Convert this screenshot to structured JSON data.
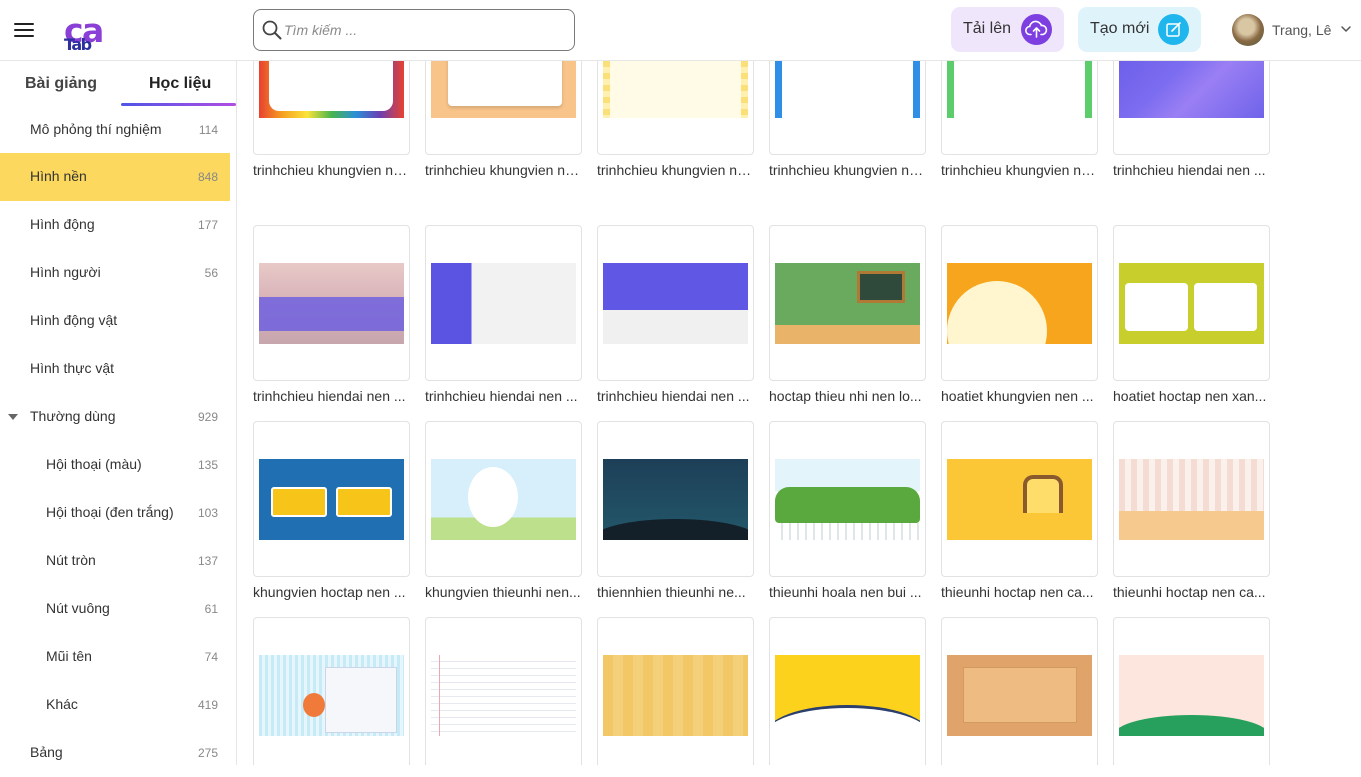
{
  "header": {
    "logo_part1": "Tab",
    "logo_part2": "ca",
    "search_placeholder": "Tìm kiếm ...",
    "upload_label": "Tải lên",
    "new_label": "Tạo mới",
    "user_name": "Trang, Lê"
  },
  "sidebar": {
    "tab_lectures": "Bài giảng",
    "tab_materials": "Học liệu",
    "items": [
      {
        "label": "Mô phỏng thí nghiệm",
        "count": "114"
      },
      {
        "label": "Hình nền",
        "count": "848"
      },
      {
        "label": "Hình động",
        "count": "177"
      },
      {
        "label": "Hình người",
        "count": "56"
      },
      {
        "label": "Hình động vật",
        "count": ""
      },
      {
        "label": "Hình thực vật",
        "count": ""
      },
      {
        "label": "Thường dùng",
        "count": "929"
      },
      {
        "label": "Hội thoại (màu)",
        "count": "135"
      },
      {
        "label": "Hội thoại (đen trắng)",
        "count": "103"
      },
      {
        "label": "Nút tròn",
        "count": "137"
      },
      {
        "label": "Nút vuông",
        "count": "61"
      },
      {
        "label": "Mũi tên",
        "count": "74"
      },
      {
        "label": "Khác",
        "count": "419"
      },
      {
        "label": "Bảng",
        "count": "275"
      }
    ]
  },
  "cards": [
    {
      "caption": "trinhchieu khungvien nen ..."
    },
    {
      "caption": "trinhchieu khungvien nen ..."
    },
    {
      "caption": "trinhchieu khungvien nen ..."
    },
    {
      "caption": "trinhchieu khungvien nen ..."
    },
    {
      "caption": "trinhchieu khungvien nen ..."
    },
    {
      "caption": "trinhchieu hiendai nen ..."
    },
    {
      "caption": "trinhchieu hiendai nen ..."
    },
    {
      "caption": "trinhchieu hiendai nen ..."
    },
    {
      "caption": "trinhchieu hiendai nen ..."
    },
    {
      "caption": "hoctap thieu nhi nen lo..."
    },
    {
      "caption": "hoatiet khungvien nen ..."
    },
    {
      "caption": "hoatiet hoctap nen xan..."
    },
    {
      "caption": "khungvien hoctap nen ..."
    },
    {
      "caption": "khungvien thieunhi nen..."
    },
    {
      "caption": "thiennhien thieunhi ne..."
    },
    {
      "caption": "thieunhi hoala nen bui ..."
    },
    {
      "caption": "thieunhi hoctap nen ca..."
    },
    {
      "caption": "thieunhi hoctap nen ca..."
    },
    {
      "caption": ""
    },
    {
      "caption": ""
    },
    {
      "caption": ""
    },
    {
      "caption": ""
    },
    {
      "caption": ""
    },
    {
      "caption": ""
    }
  ]
}
